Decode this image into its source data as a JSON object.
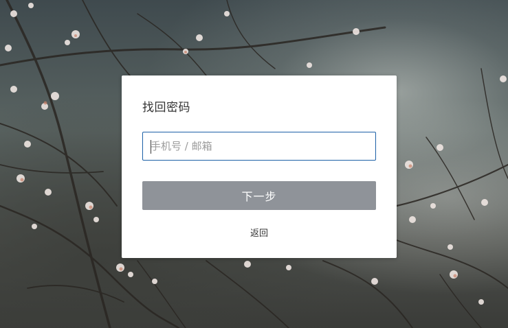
{
  "dialog": {
    "title": "找回密码",
    "account_input": {
      "value": "",
      "placeholder": "手机号 / 邮箱"
    },
    "next_button_label": "下一步",
    "back_link_label": "返回"
  },
  "colors": {
    "input_border": "#1a5fa6",
    "button_bg": "#8f9399",
    "button_text": "#ffffff",
    "dialog_bg": "#ffffff"
  }
}
